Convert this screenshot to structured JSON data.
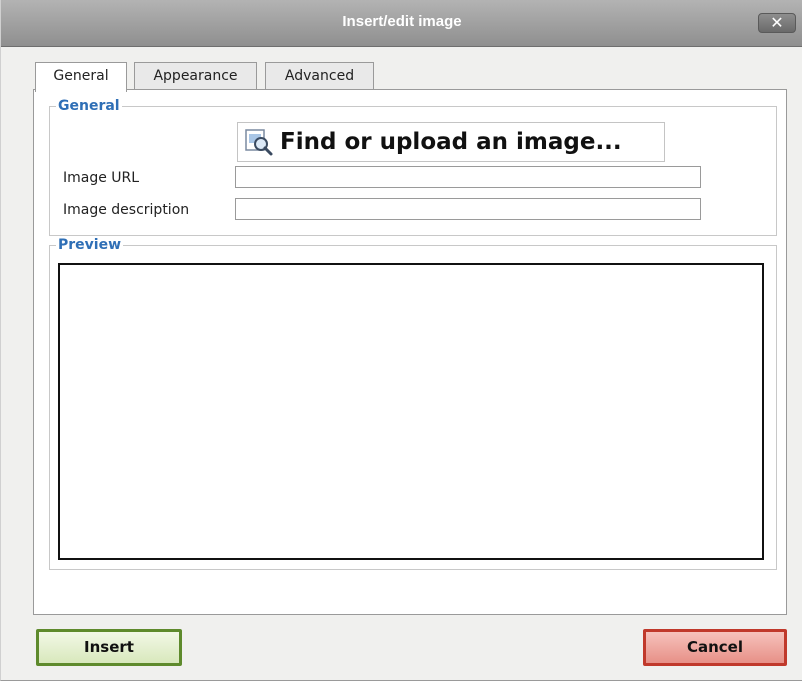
{
  "window": {
    "title": "Insert/edit image",
    "close_glyph": "✕"
  },
  "tabs": [
    {
      "label": "General",
      "active": true
    },
    {
      "label": "Appearance",
      "active": false
    },
    {
      "label": "Advanced",
      "active": false
    }
  ],
  "general": {
    "legend": "General",
    "find_button_label": "Find or upload an image...",
    "find_button_icon": "magnifier-image-icon",
    "image_url_label": "Image URL",
    "image_url_value": "",
    "image_description_label": "Image description",
    "image_description_value": ""
  },
  "preview": {
    "legend": "Preview"
  },
  "actions": {
    "insert_label": "Insert",
    "cancel_label": "Cancel"
  },
  "colors": {
    "legend": "#2f6fb6",
    "insert_border": "#5e8a2c",
    "cancel_border": "#c0392b",
    "titlebar": "#9f9f9f"
  }
}
